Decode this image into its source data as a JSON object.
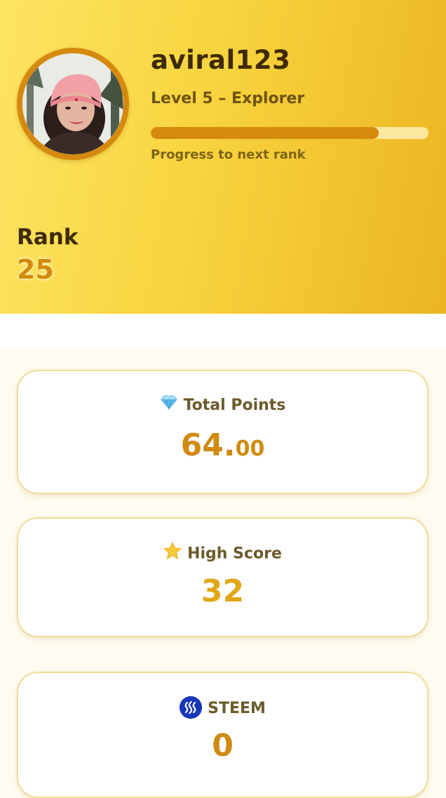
{
  "profile": {
    "username": "aviral123",
    "level_text": "Level 5 – Explorer",
    "progress_fraction": 0.82,
    "progress_label": "Progress to next rank",
    "rank_label": "Rank",
    "rank_value": "25"
  },
  "stats": {
    "total_points": {
      "label": "Total Points",
      "icon": "gem-icon",
      "value_int": "64.",
      "value_dec": "00"
    },
    "high_score": {
      "label": "High Score",
      "icon": "star-icon",
      "value": "32"
    },
    "steem": {
      "label": "STEEM",
      "icon": "steem-icon",
      "value": "0"
    }
  },
  "colors": {
    "header_gradient_start": "#fde463",
    "header_gradient_end": "#ebb522",
    "accent": "#d58a0f",
    "progress_track": "#fbe7a0",
    "card_border": "#f1dc96"
  }
}
